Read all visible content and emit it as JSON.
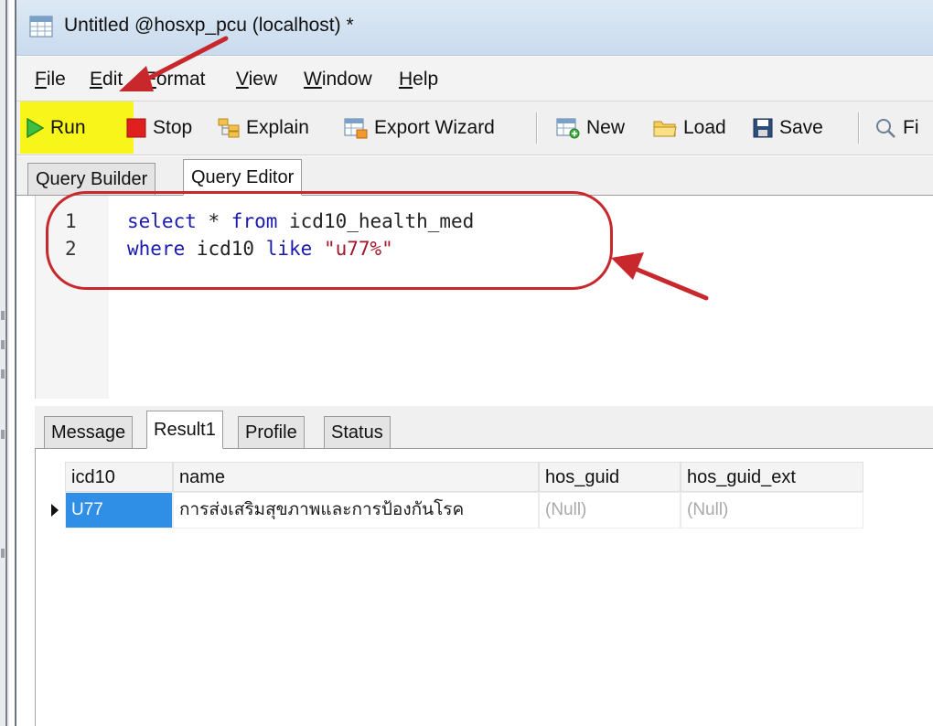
{
  "window": {
    "title": "Untitled @hosxp_pcu (localhost) *"
  },
  "menubar": {
    "items": [
      {
        "label": "File",
        "u": "F",
        "rest": "ile"
      },
      {
        "label": "Edit",
        "u": "E",
        "rest": "dit"
      },
      {
        "label": "Format",
        "u": "F",
        "rest": "ormat"
      },
      {
        "label": "View",
        "u": "V",
        "rest": "iew"
      },
      {
        "label": "Window",
        "u": "W",
        "rest": "indow"
      },
      {
        "label": "Help",
        "u": "H",
        "rest": "elp"
      }
    ]
  },
  "toolbar": {
    "run": "Run",
    "stop": "Stop",
    "explain": "Explain",
    "export": "Export Wizard",
    "new": "New",
    "load": "Load",
    "save": "Save",
    "find": "Fi",
    "highlight_color": "#f7f51a"
  },
  "editor_tabs": [
    "Query Builder",
    "Query Editor"
  ],
  "editor": {
    "lines": [
      {
        "num": "1",
        "tokens": [
          [
            "kw",
            "select"
          ],
          [
            "id",
            " * "
          ],
          [
            "kw",
            "from"
          ],
          [
            "id",
            " icd10_health_med"
          ]
        ]
      },
      {
        "num": "2",
        "tokens": [
          [
            "kw",
            "where"
          ],
          [
            "id",
            " icd10 "
          ],
          [
            "kw",
            "like"
          ],
          [
            "id",
            " "
          ],
          [
            "str",
            "\"u77%\""
          ]
        ]
      }
    ]
  },
  "result_tabs": [
    "Message",
    "Result1",
    "Profile",
    "Status"
  ],
  "grid": {
    "columns": [
      "icd10",
      "name",
      "hos_guid",
      "hos_guid_ext"
    ],
    "rows": [
      [
        "U77",
        "การส่งเสริมสุขภาพและการป้องกันโรค",
        "(Null)",
        "(Null)"
      ]
    ]
  },
  "annotation_color": "#c8272c"
}
